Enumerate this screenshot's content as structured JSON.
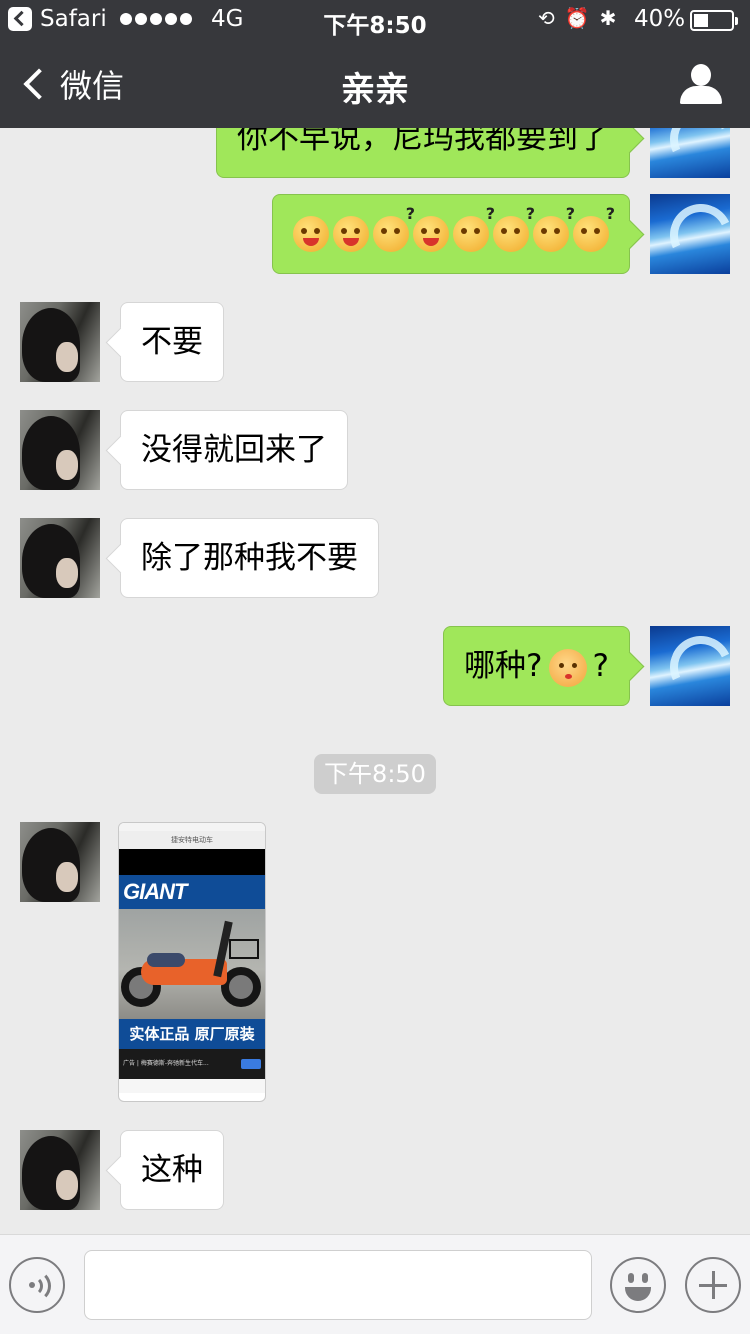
{
  "status_bar": {
    "back_app": "Safari",
    "network": "4G",
    "time": "下午8:50",
    "battery_percent": "40%",
    "battery_level": 0.4
  },
  "nav": {
    "back_label": "微信",
    "title": "亲亲"
  },
  "messages": [
    {
      "sender": "self",
      "type": "text",
      "text": "你不早说，尼玛我都要到了"
    },
    {
      "sender": "self",
      "type": "emoji",
      "emojis": [
        "grimace-emoji",
        "grimace-emoji",
        "confused-emoji",
        "grimace-emoji",
        "confused-emoji",
        "confused-emoji",
        "confused-emoji",
        "confused-emoji"
      ]
    },
    {
      "sender": "other",
      "type": "text",
      "text": "不要"
    },
    {
      "sender": "other",
      "type": "text",
      "text": "没得就回来了"
    },
    {
      "sender": "other",
      "type": "text",
      "text": "除了那种我不要"
    },
    {
      "sender": "self",
      "type": "text",
      "text_before": "哪种?",
      "text_after": "?"
    },
    {
      "sender": "other",
      "type": "image"
    },
    {
      "sender": "other",
      "type": "text",
      "text": "这种"
    }
  ],
  "timestamp_chip": "下午8:50",
  "image_message": {
    "url_text": "捷安特电动车",
    "logo_text": "GIANT",
    "slogan": "实体正品 原厂原装",
    "ad_text": "广告 | 梅赛德斯-奔驰新生代车..."
  },
  "colors": {
    "nav_bg": "#37383c",
    "chat_bg": "#ebebeb",
    "outgoing_bubble": "#a0e75a",
    "incoming_bubble": "#ffffff"
  }
}
